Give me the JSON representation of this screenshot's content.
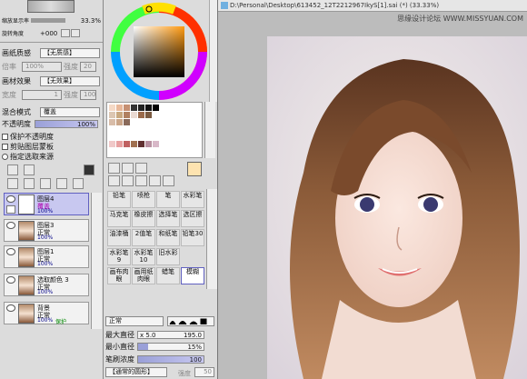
{
  "left": {
    "layer_zoom_label": "缩放显示率",
    "layer_zoom_value": "33.3%",
    "layer_rotate_label": "旋转角度",
    "layer_rotate_value": "+000",
    "paper_texture_label": "画纸质感",
    "paper_texture_value": "【无质感】",
    "scale_label": "倍率",
    "scale_value": "100%",
    "strength_label": "强度",
    "strength_value": "20",
    "material_label": "画材效果",
    "material_value": "【无效果】",
    "width_label": "宽度",
    "width_value": "1",
    "strength2_value": "100",
    "blend_label": "混合模式",
    "blend_value": "覆盖",
    "opacity_label": "不透明度",
    "opacity_value": "100%",
    "protect_label": "保护不透明度",
    "clip_label": "剪贴图层蒙板",
    "select_source_label": "指定选取来源",
    "layers": [
      {
        "name": "图层4",
        "mode": "覆盖",
        "opacity": "100%"
      },
      {
        "name": "图层3",
        "mode": "正常",
        "opacity": "100%"
      },
      {
        "name": "图层1",
        "mode": "正常",
        "opacity": "100%"
      },
      {
        "name": "选取颜色 3",
        "mode": "正常",
        "opacity": "100%"
      },
      {
        "name": "背景",
        "mode": "正常",
        "opacity": "100%",
        "extra": "保护"
      }
    ]
  },
  "tools": {
    "rows": [
      [
        "铅笔",
        "喷枪",
        "笔",
        "水彩笔"
      ],
      [
        "马克笔",
        "橡皮擦",
        "选择笔",
        "选区擦"
      ],
      [
        "油漆桶",
        "2值笔",
        "和纸笔",
        "铅笔30"
      ],
      [
        "水彩笔9",
        "水彩笔10",
        "旧水彩",
        ""
      ],
      [
        "画布肉眼",
        "画用纸肉眼",
        "蜡笔",
        "模糊"
      ]
    ],
    "blend_mode": "正常",
    "max_diameter_label": "最大直径",
    "max_diameter_mult": "x 5.0",
    "max_diameter_value": "195.0",
    "min_diameter_label": "最小直径",
    "min_diameter_value": "15%",
    "brush_density_label": "笔刷浓度",
    "brush_density_value": "100",
    "shape_label": "【通常的圆形】",
    "shape_strength": "强度",
    "shape_value": "50"
  },
  "canvas": {
    "title": "D:\\Personal\\Desktop\\613452_12T2212967IkyS[1].sai (*) (33.33%)",
    "watermark": "思缘设计论坛 WWW.MISSYUAN.COM"
  },
  "colors": {
    "accent_blue": "#3030d0",
    "layer_active": "#c8c8f0",
    "fg_color": "#fde3b0",
    "bg_color": "#c8f0ff"
  }
}
